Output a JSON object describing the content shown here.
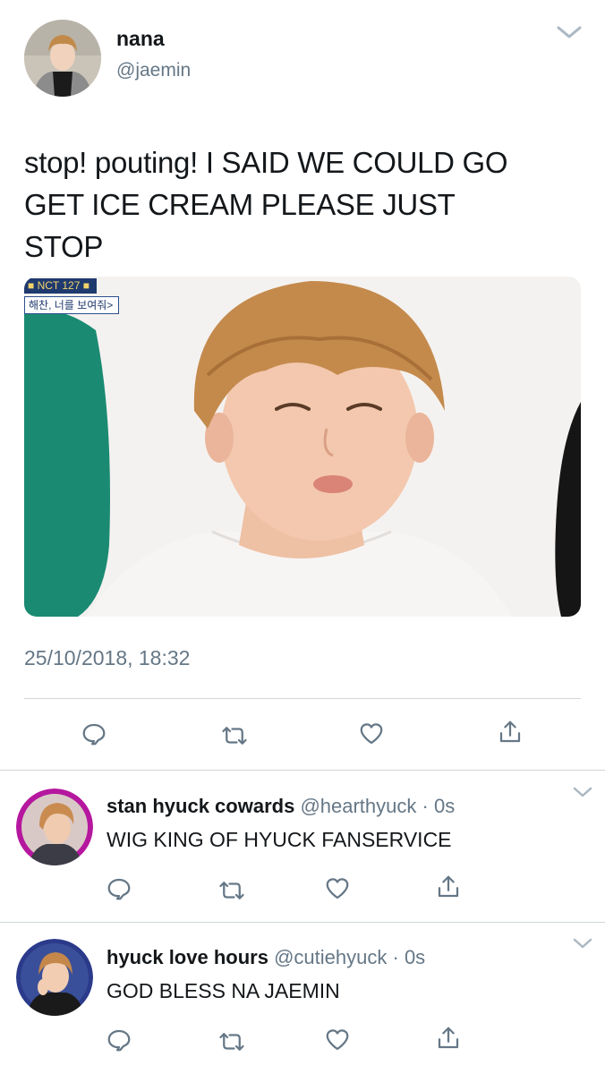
{
  "tweet": {
    "display_name": "nana",
    "handle": "@jaemin",
    "text_lines": [
      "stop! pouting! I SAID WE COULD GO",
      "GET ICE CREAM PLEASE JUST",
      "STOP"
    ],
    "media": {
      "badge": "■ NCT 127 ■",
      "caption": "해찬, 너를 보여줘>"
    },
    "timestamp": "25/10/2018, 18:32"
  },
  "replies": [
    {
      "display_name": "stan hyuck cowards",
      "handle": "@hearthyuck",
      "dot": "·",
      "time": "0s",
      "text": "WIG KING OF HYUCK FANSERVICE",
      "avatar_ring": "#b5179e"
    },
    {
      "display_name": "hyuck love hours",
      "handle": "@cutiehyuck",
      "dot": "·",
      "time": "0s",
      "text": "GOD BLESS NA JAEMIN",
      "avatar_ring": "#2b3a8a"
    }
  ],
  "colors": {
    "text": "#14171a",
    "secondary": "#657786",
    "divider": "#d0d6db",
    "icon": "#657786"
  },
  "icons": [
    "chevron-down-icon",
    "reply-icon",
    "retweet-icon",
    "like-icon",
    "share-icon"
  ]
}
